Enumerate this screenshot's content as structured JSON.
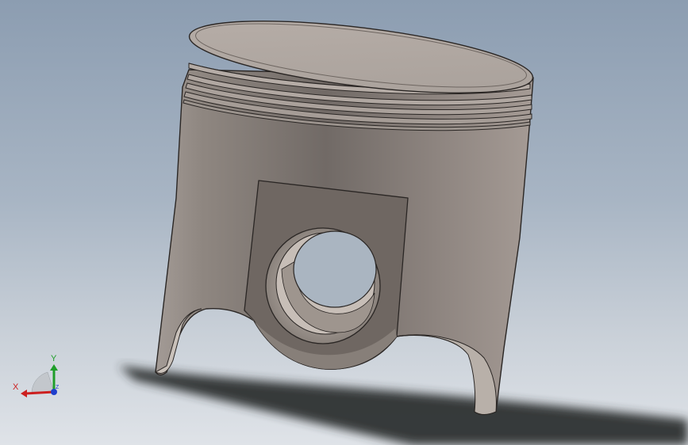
{
  "viewport": {
    "background_top": "#8c9db1",
    "background_bottom": "#dfe3e8"
  },
  "model": {
    "part": "piston",
    "body_color": "#8f8781",
    "shadow_color": "#2e3033"
  },
  "triad": {
    "x_label": "X",
    "y_label": "Y",
    "z_label": "Z",
    "x_color": "#cc1f1f",
    "y_color": "#1f9e2a",
    "z_color": "#1f3fcc"
  }
}
